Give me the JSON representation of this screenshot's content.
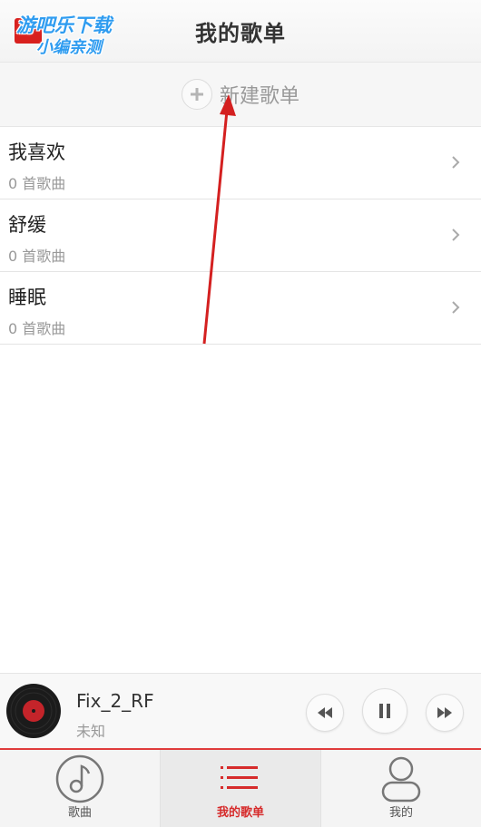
{
  "header": {
    "title": "我的歌单",
    "watermark_line1": "游吧乐下载",
    "watermark_line2": "小编亲测"
  },
  "new_playlist": {
    "label": "新建歌单"
  },
  "playlists": [
    {
      "name": "我喜欢",
      "count": "0 首歌曲"
    },
    {
      "name": "舒缓",
      "count": "0 首歌曲"
    },
    {
      "name": "睡眠",
      "count": "0 首歌曲"
    }
  ],
  "player": {
    "title": "Fix_2_RF",
    "artist": "未知"
  },
  "tabs": [
    {
      "label": "歌曲",
      "icon": "music-note-icon"
    },
    {
      "label": "我的歌单",
      "icon": "list-icon"
    },
    {
      "label": "我的",
      "icon": "user-icon"
    }
  ],
  "colors": {
    "accent_red": "#d62b2b",
    "annotation_arrow": "#d42020"
  }
}
